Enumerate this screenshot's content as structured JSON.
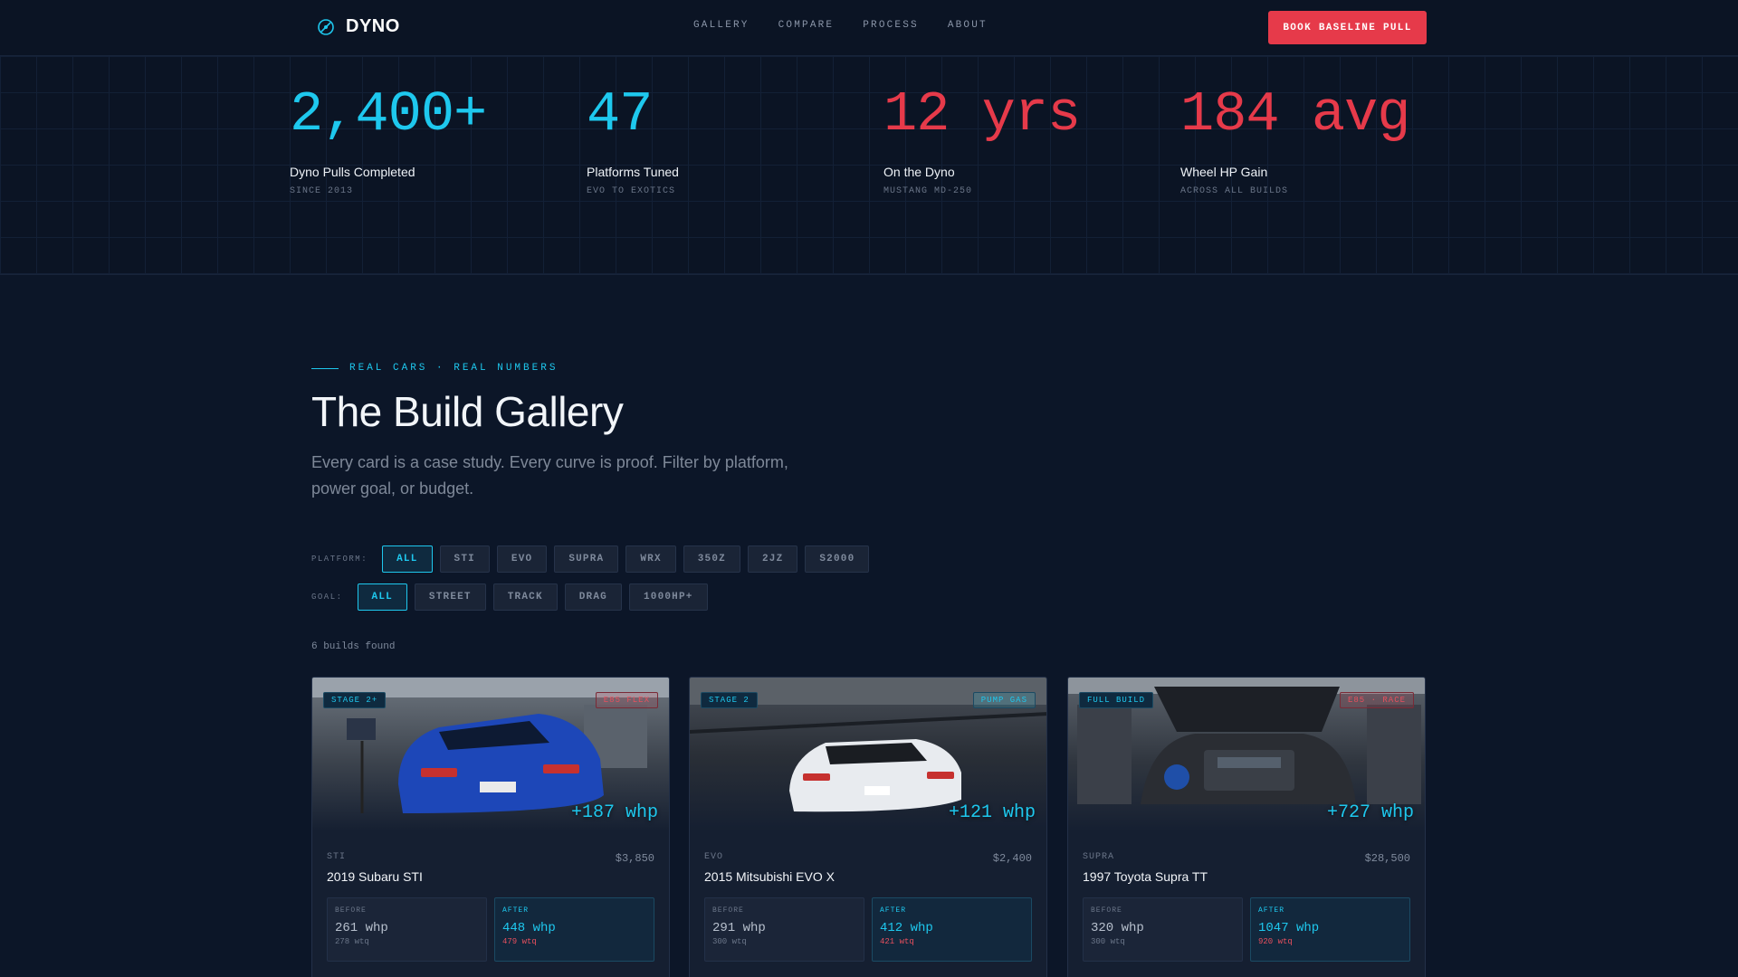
{
  "nav": {
    "brand": "DYNO",
    "links": [
      "GALLERY",
      "COMPARE",
      "PROCESS",
      "ABOUT"
    ],
    "cta": "BOOK BASELINE PULL"
  },
  "stats": [
    {
      "value": "2,400+",
      "label": "Dyno Pulls Completed",
      "sub": "SINCE 2013",
      "color": "#1ec8ee"
    },
    {
      "value": "47",
      "label": "Platforms Tuned",
      "sub": "EVO TO EXOTICS",
      "color": "#1ec8ee"
    },
    {
      "value": "12 yrs",
      "label": "On the Dyno",
      "sub": "MUSTANG MD-250",
      "color": "#e63a4a"
    },
    {
      "value": "184 avg",
      "label": "Wheel HP Gain",
      "sub": "ACROSS ALL BUILDS",
      "color": "#e63a4a"
    }
  ],
  "gallery": {
    "eyebrow": "REAL CARS · REAL NUMBERS",
    "title": "The Build Gallery",
    "lede": "Every card is a case study. Every curve is proof. Filter by platform, power goal, or budget."
  },
  "filters": {
    "platform_label": "PLATFORM:",
    "platform": [
      "ALL",
      "STI",
      "EVO",
      "SUPRA",
      "WRX",
      "350Z",
      "2JZ",
      "S2000"
    ],
    "platform_selected": "ALL",
    "goal_label": "GOAL:",
    "goal": [
      "ALL",
      "STREET",
      "TRACK",
      "DRAG",
      "1000HP+"
    ],
    "goal_selected": "ALL"
  },
  "results_count": "6 builds found",
  "builds": [
    {
      "badge_left": "STAGE 2+",
      "badge_right": "E85 FLEX",
      "badge_right_color": "red",
      "gain": "+187 whp",
      "platform": "STI",
      "price": "$3,850",
      "name": "2019 Subaru STI",
      "before_label": "BEFORE",
      "before_whp": "261 whp",
      "before_wtq": "278 wtq",
      "after_label": "AFTER",
      "after_whp": "448 whp",
      "after_wtq": "479 wtq",
      "car_color": "#1d47b8"
    },
    {
      "badge_left": "STAGE 2",
      "badge_right": "PUMP GAS",
      "badge_right_color": "cyan",
      "gain": "+121 whp",
      "platform": "EVO",
      "price": "$2,400",
      "name": "2015 Mitsubishi EVO X",
      "before_label": "BEFORE",
      "before_whp": "291 whp",
      "before_wtq": "300 wtq",
      "after_label": "AFTER",
      "after_whp": "412 whp",
      "after_wtq": "421 wtq",
      "car_color": "#e8ebef"
    },
    {
      "badge_left": "FULL BUILD",
      "badge_right": "E85 · RACE",
      "badge_right_color": "red",
      "gain": "+727 whp",
      "platform": "SUPRA",
      "price": "$28,500",
      "name": "1997 Toyota Supra TT",
      "before_label": "BEFORE",
      "before_whp": "320 whp",
      "before_wtq": "300 wtq",
      "after_label": "AFTER",
      "after_whp": "1047 whp",
      "after_wtq": "920 wtq",
      "car_color": "#2a2d33"
    }
  ]
}
